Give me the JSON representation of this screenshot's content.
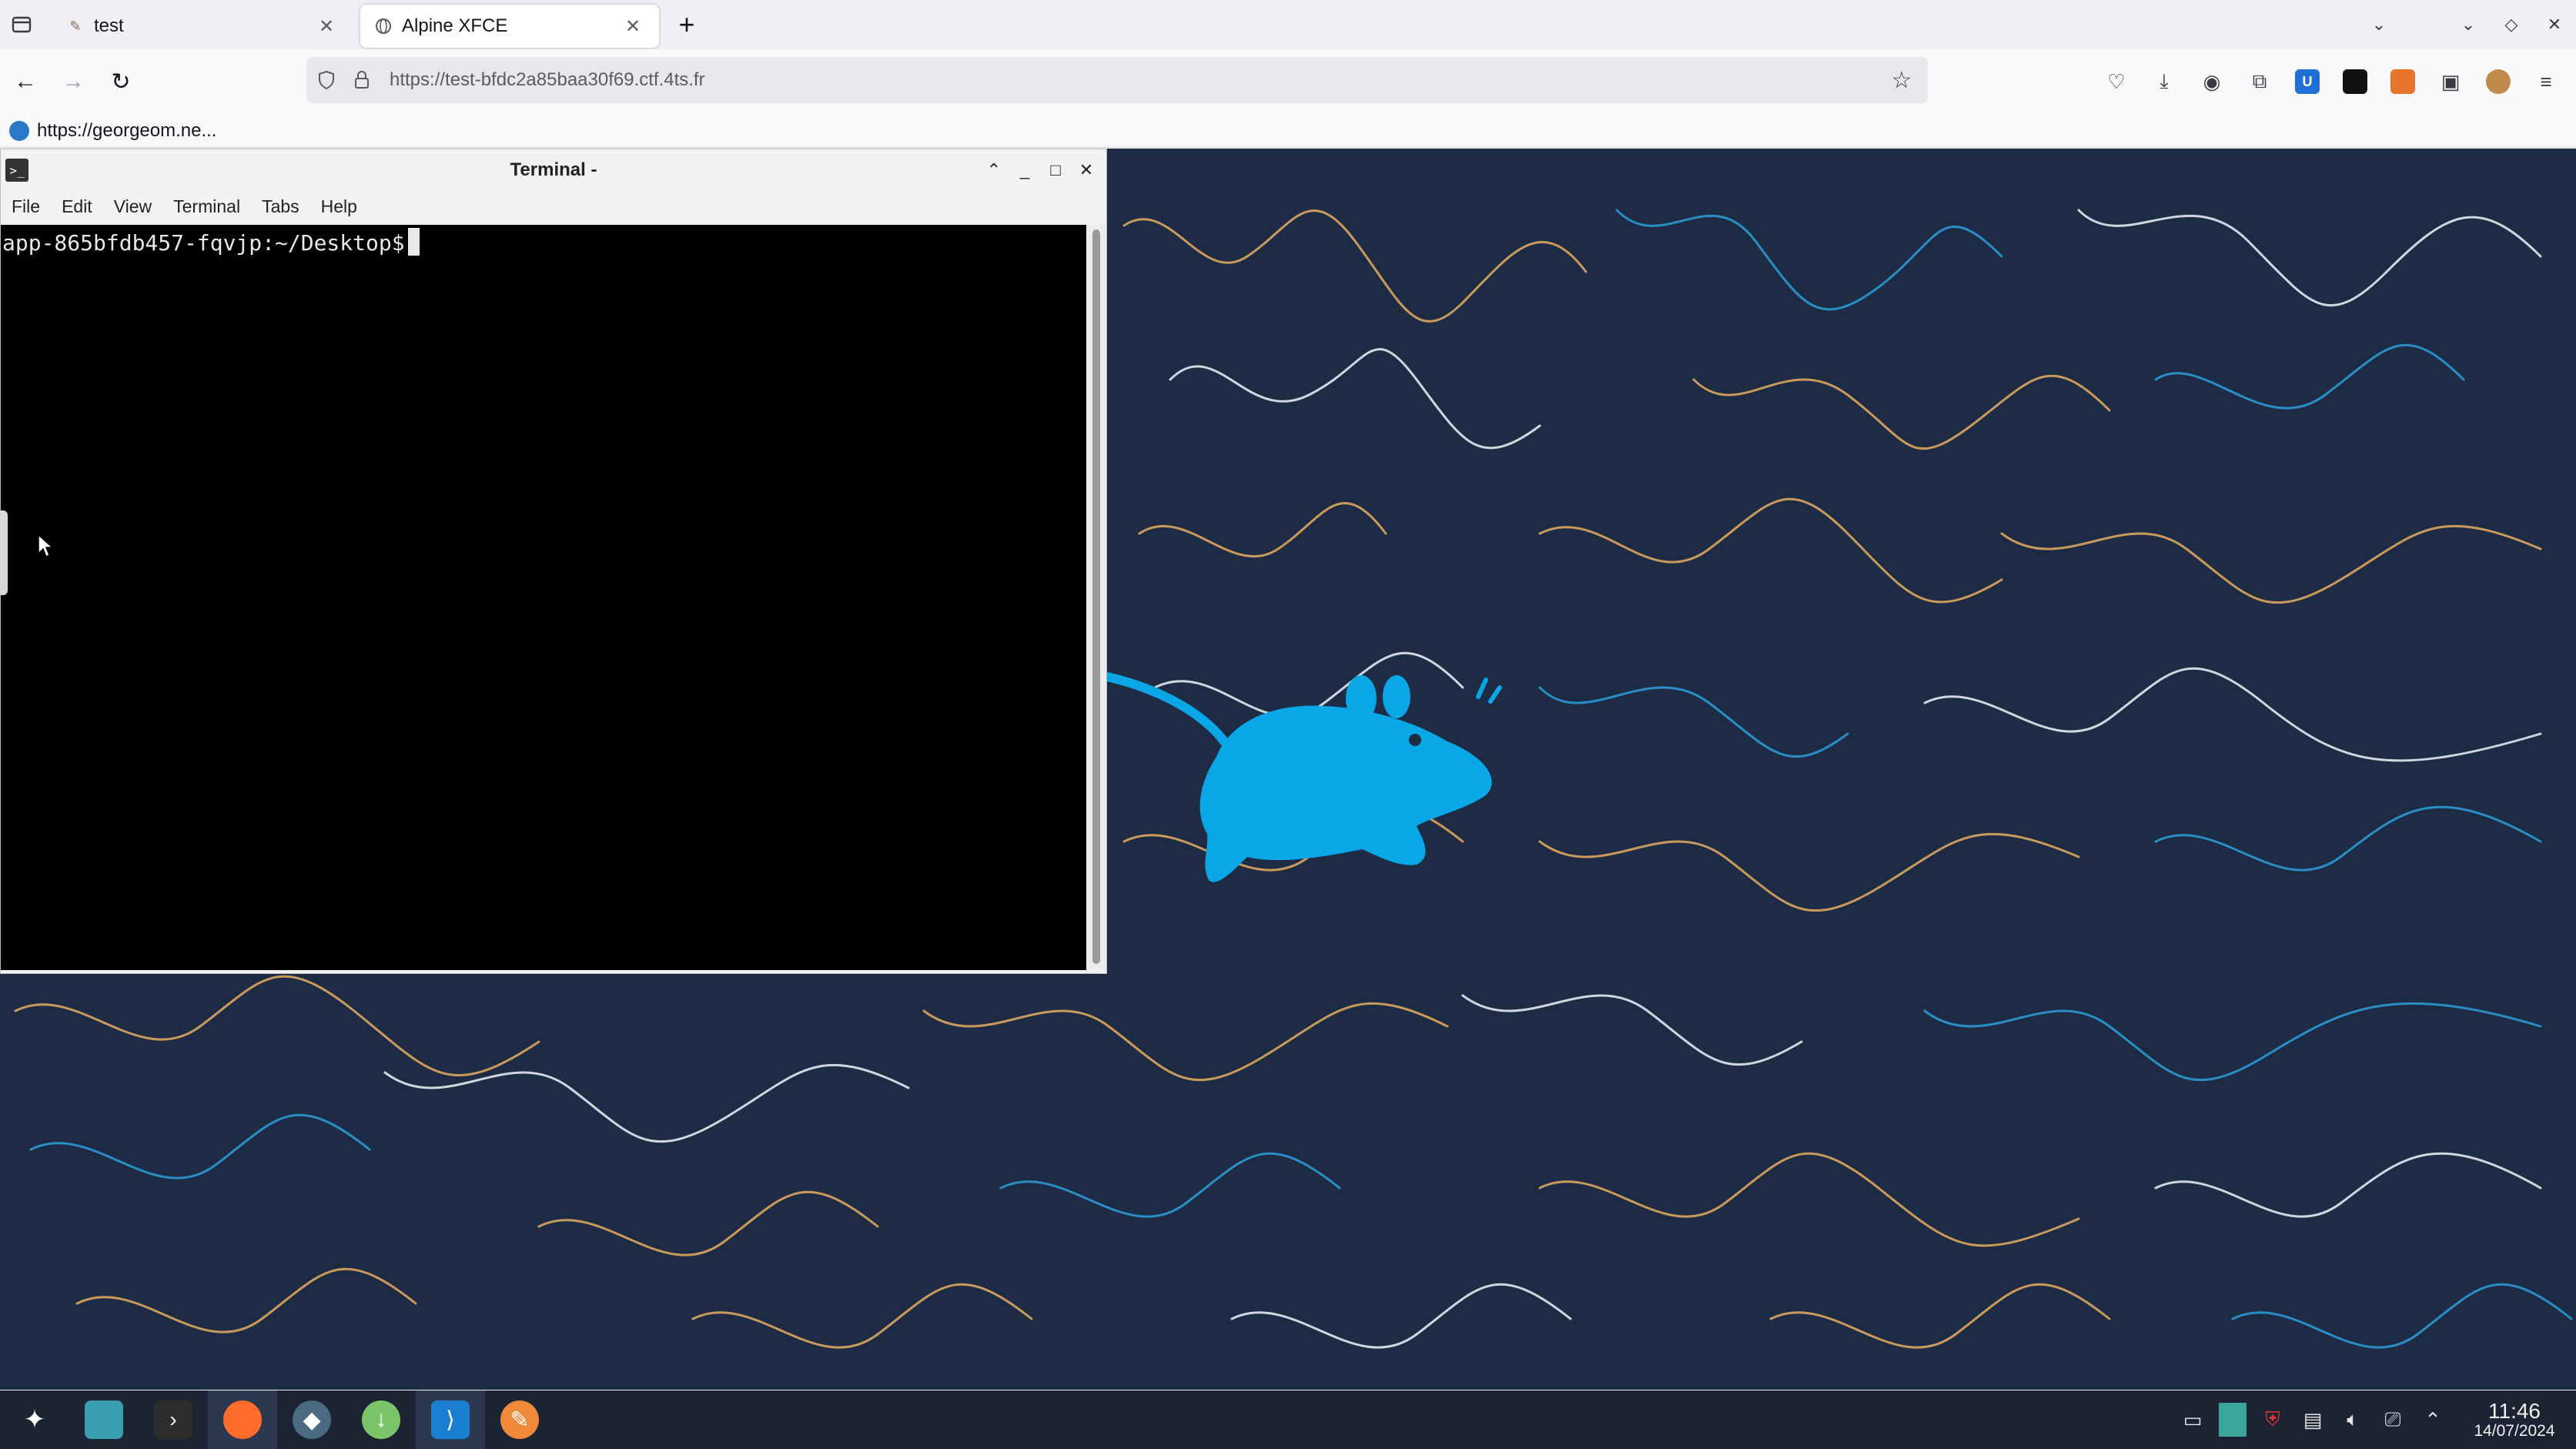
{
  "browser": {
    "tabs": [
      {
        "title": "test",
        "active": false
      },
      {
        "title": "Alpine XFCE",
        "active": true
      }
    ],
    "url": "https://test-bfdc2a85baa30f69.ctf.4ts.fr",
    "bookmark": "https://georgeom.ne..."
  },
  "terminal": {
    "title": "Terminal -",
    "menu": [
      "File",
      "Edit",
      "View",
      "Terminal",
      "Tabs",
      "Help"
    ],
    "prompt": "app-865bfdb457-fqvjp:~/Desktop$"
  },
  "taskbar": {
    "time": "11:46",
    "date": "14/07/2024"
  },
  "colors": {
    "desktop_bg": "#1d2b44",
    "mouse_blue": "#0aa7e6",
    "line_orange": "#c99a5b",
    "line_cyan": "#2a8ec6",
    "line_white": "#cfd6e0"
  }
}
